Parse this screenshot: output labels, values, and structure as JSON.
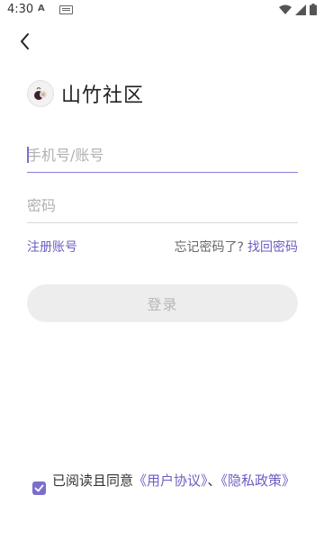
{
  "status": {
    "time": "4:30",
    "indicator": "A"
  },
  "app": {
    "title": "山竹社区",
    "logo_icon": "mangosteen-logo-icon"
  },
  "form": {
    "phone_placeholder": "手机号/账号",
    "password_placeholder": "密码"
  },
  "links": {
    "register": "注册账号",
    "forgot_question": "忘记密码了?",
    "retrieve": "找回密码"
  },
  "login_button": "登录",
  "agreement": {
    "checked": true,
    "prefix": "已阅读且同意",
    "user_agreement": "《用户协议》",
    "separator": "、",
    "privacy_policy": "《隐私政策》"
  },
  "colors": {
    "accent": "#7a6fcf",
    "link": "#6b5fc2",
    "button_bg": "#ededed"
  }
}
